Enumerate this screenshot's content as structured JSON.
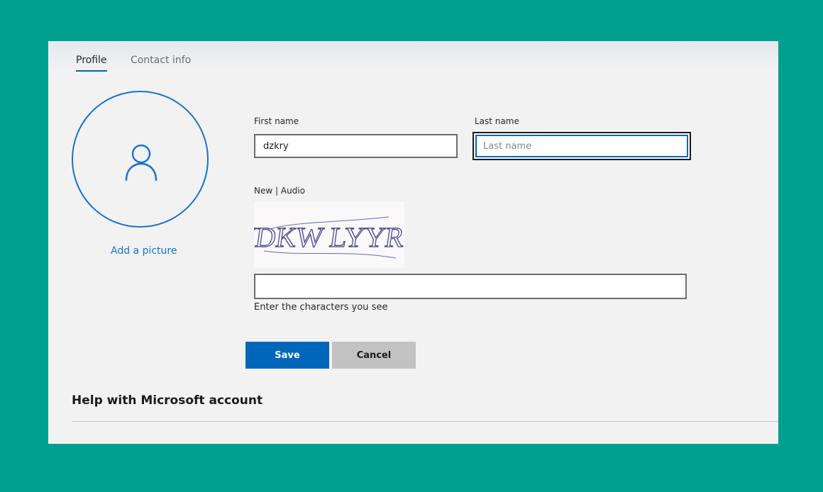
{
  "tabs": {
    "profile": "Profile",
    "contact_info": "Contact info"
  },
  "avatar": {
    "icon": "person-icon",
    "add_picture": "Add a picture"
  },
  "form": {
    "first_name_label": "First name",
    "first_name_value": "dzkry",
    "last_name_label": "Last name",
    "last_name_value": "",
    "last_name_placeholder": "Last name"
  },
  "captcha": {
    "new_link": "New",
    "separator": " | ",
    "audio_link": "Audio",
    "image_text": "VDKW LYYRG",
    "input_value": "",
    "hint": "Enter the characters you see"
  },
  "buttons": {
    "save": "Save",
    "cancel": "Cancel"
  },
  "help": {
    "heading": "Help with Microsoft account"
  },
  "colors": {
    "background": "#009f90",
    "accent": "#0067b8",
    "link": "#1a73c4"
  }
}
